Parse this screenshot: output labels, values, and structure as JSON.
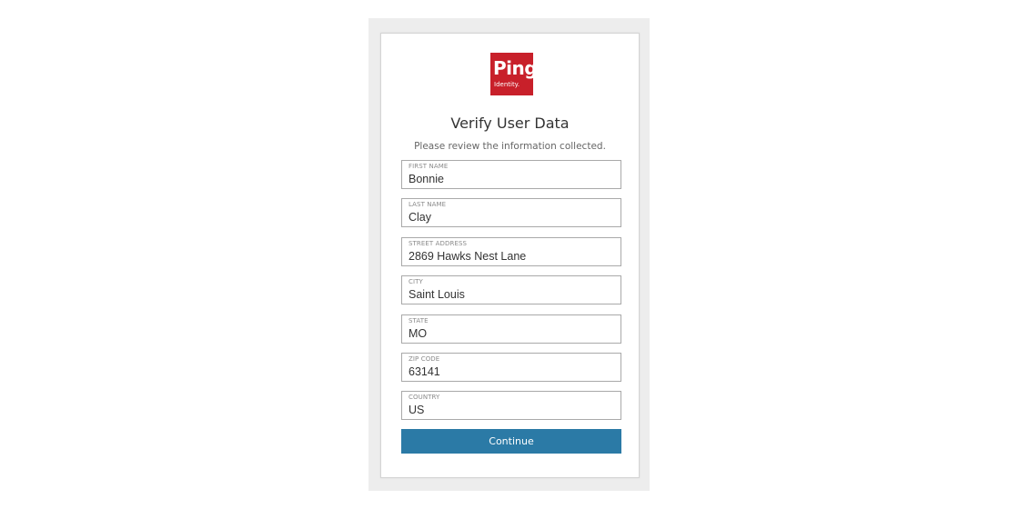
{
  "logo": {
    "word": "Ping",
    "sub": "Identity.",
    "color": "#c8202a"
  },
  "form": {
    "title": "Verify User Data",
    "subtitle": "Please review the information collected.",
    "fields": [
      {
        "label": "FIRST NAME",
        "value": "Bonnie"
      },
      {
        "label": "LAST NAME",
        "value": "Clay"
      },
      {
        "label": "STREET ADDRESS",
        "value": "2869 Hawks Nest Lane"
      },
      {
        "label": "CITY",
        "value": "Saint Louis"
      },
      {
        "label": "STATE",
        "value": "MO"
      },
      {
        "label": "ZIP CODE",
        "value": "63141"
      },
      {
        "label": "COUNTRY",
        "value": "US"
      }
    ],
    "continue_label": "Continue",
    "button_color": "#2b7aa6"
  }
}
